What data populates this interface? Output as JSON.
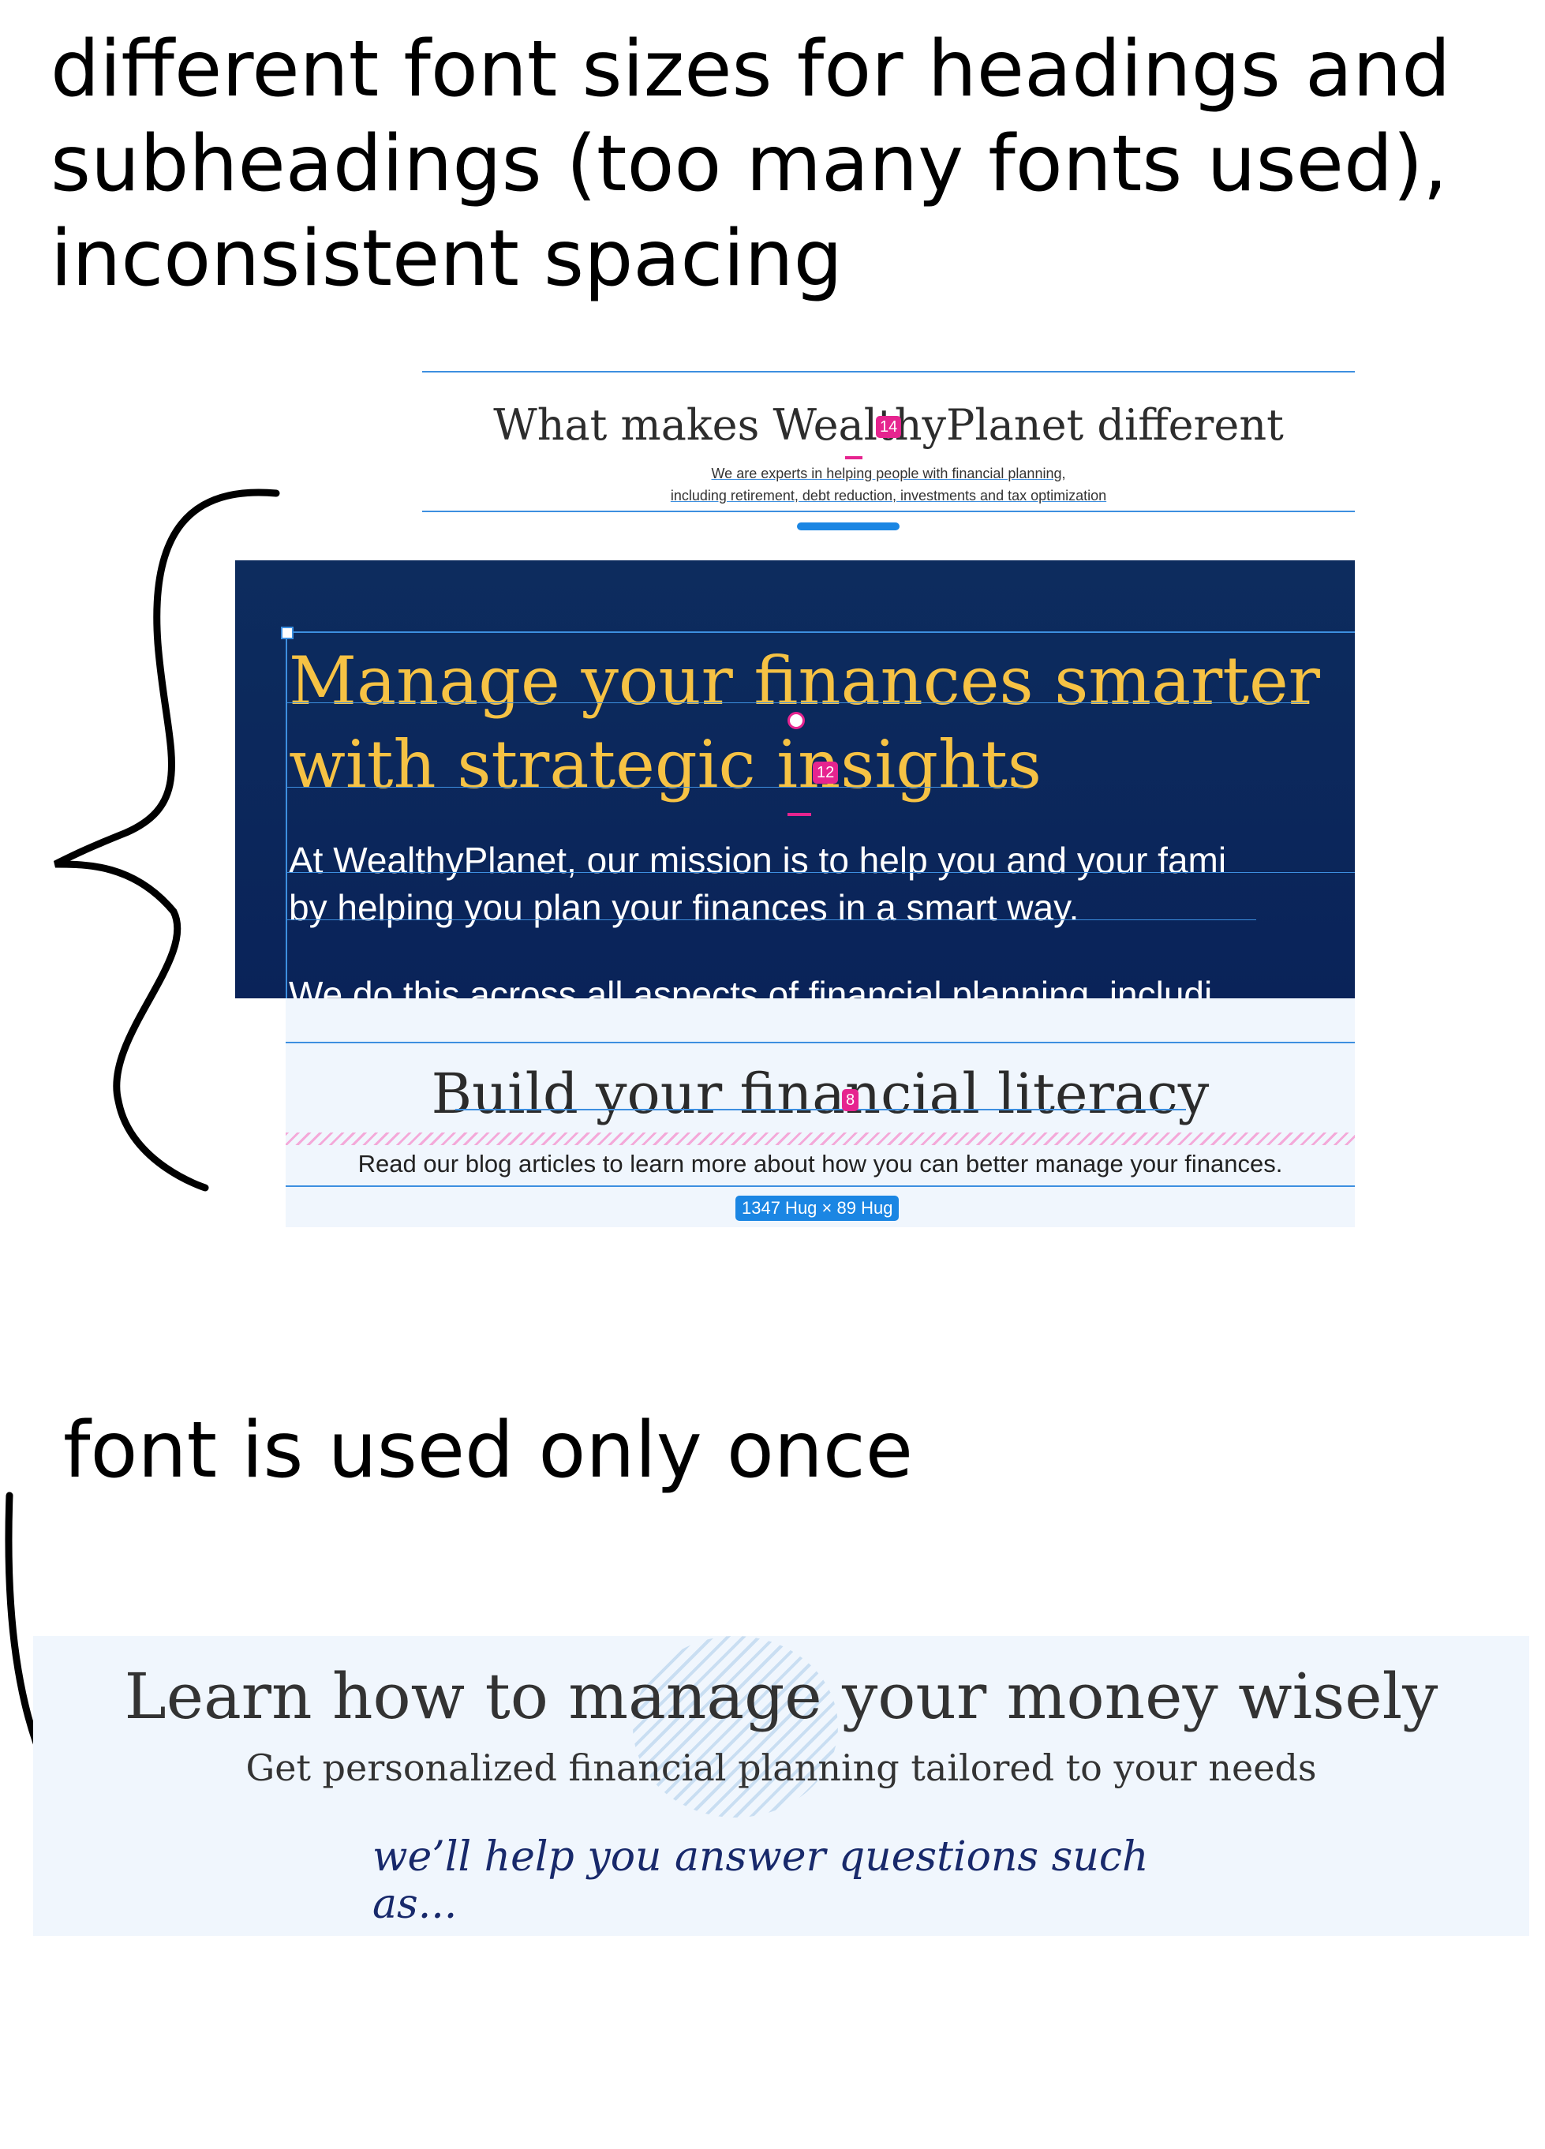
{
  "annotations": {
    "top_note": "different font sizes for headings and subheadings (too many fonts used), inconsistent spacing",
    "bottom_note": "font is used only once"
  },
  "block_different": {
    "title": "What makes WealthyPlanet different",
    "subtitle_line1": "We are experts in helping people with financial planning,",
    "subtitle_line2": "including retirement, debt reduction, investments and tax optimization",
    "spacing_badge": "14"
  },
  "hero": {
    "title": "Manage your finances smarter with strategic insights",
    "paragraph1_line1": "At WealthyPlanet, our mission is to help you and your fami",
    "paragraph1_line2": "by helping you plan your finances in a smart way.",
    "paragraph2": "We do this across all aspects of financial planning, includi",
    "spacing_badge": "12"
  },
  "literacy": {
    "title": "Build your financial literacy",
    "subtitle": "Read our blog articles to learn more about how you can better manage your finances.",
    "spacing_badge": "8",
    "size_tag": "1347 Hug × 89 Hug"
  },
  "learn": {
    "title": "Learn how to manage your money wisely",
    "subtitle": "Get personalized financial planning tailored to your needs",
    "script_line": "we’ll help you answer questions such as..."
  },
  "colors": {
    "hero_bg": "#0b275c",
    "hero_title": "#f6c244",
    "guide": "#3d8fe0",
    "badge": "#e6248f",
    "script": "#18296b"
  }
}
